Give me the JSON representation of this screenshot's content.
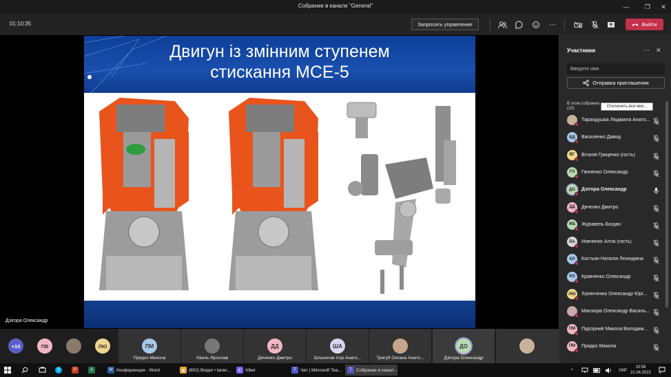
{
  "window": {
    "title": "Собрание в канале \"General\""
  },
  "toolbar": {
    "timer": "01:10:35",
    "request_control": "Запросить управление",
    "leave": "Выйти"
  },
  "slide": {
    "title_line1": "Двигун із змінним ступенем",
    "title_line2": "стискання MCE-5"
  },
  "stage": {
    "speaker": "Дзігора Олександр"
  },
  "panel": {
    "title": "Участники",
    "search_placeholder": "Введите имя",
    "invite": "Отправка приглашения",
    "section_line1": "В этом собрании",
    "section_line2": "(20)",
    "mute_all": "Отключить все мик...",
    "participants": [
      {
        "name": "Тарандушка Людмила Анато...",
        "initials": "",
        "color": "#c8b39a",
        "photo": true
      },
      {
        "name": "Василенко Давид",
        "initials": "ВД",
        "color": "#a6c8ea"
      },
      {
        "name": "Віталій Гриценко (гость)",
        "initials": "ВГ",
        "color": "#f0d58c"
      },
      {
        "name": "Ганненко Олександр",
        "initials": "ГО",
        "color": "#b7dcb0"
      },
      {
        "name": "Дзігора Олександр",
        "initials": "ДО",
        "color": "#b7dcb0"
      },
      {
        "name": "Дяченко Дмитро",
        "initials": "ДД",
        "color": "#f1b7c1"
      },
      {
        "name": "Журавель Богдан",
        "initials": "ЖБ",
        "color": "#b7dcb0"
      },
      {
        "name": "Йовченко Алла (гость)",
        "initials": "ЙА",
        "color": "#d9d9d9"
      },
      {
        "name": "Костьян Наталія Леонідівна",
        "initials": "КЛ",
        "color": "#a6c8ea"
      },
      {
        "name": "Кравченко Олександр",
        "initials": "КО",
        "color": "#a6c8ea"
      },
      {
        "name": "Лукянченко Олександр Юрі...",
        "initials": "ЛЮ",
        "color": "#f0d58c"
      },
      {
        "name": "Манзюра Олександр Василь...",
        "initials": "",
        "color": "#c9a9a9",
        "photo": true
      },
      {
        "name": "Підгорний Микола Володим...",
        "initials": "ПМ",
        "color": "#f1b7c1"
      },
      {
        "name": "Прядко Микола",
        "initials": "ПМ",
        "color": "#f1b7c1"
      }
    ]
  },
  "tiles": {
    "overflow": "+10",
    "small": [
      {
        "initials": "ПВ",
        "color": "#f1b7c1"
      },
      {
        "initials": "ЛЮ",
        "color": "#f0d58c"
      }
    ],
    "named": [
      {
        "name": "Прядко Микола",
        "initials": "ПМ",
        "color": "#a6c8ea"
      },
      {
        "name": "Хвиль Ярослав",
        "initials": "",
        "color": "#777"
      },
      {
        "name": "Дяченко Дмитро",
        "initials": "ДД",
        "color": "#f1b7c1"
      },
      {
        "name": "Шльончак Ігор Анато...",
        "initials": "ША",
        "color": "#d9d4ef"
      },
      {
        "name": "Тригуб Оксана Анато...",
        "initials": "",
        "color": "#c8a58a"
      },
      {
        "name": "Дзігора Олександр",
        "initials": "ДО",
        "color": "#b7dcb0"
      }
    ]
  },
  "taskbar": {
    "apps": [
      {
        "label": "Конференция - Word",
        "color": "#2b579a",
        "glyph": "W"
      },
      {
        "label": "(802) Вхідні • taran...",
        "color": "#e2a33a",
        "glyph": "◉"
      },
      {
        "label": "Viber",
        "color": "#7360f2",
        "glyph": "✆"
      },
      {
        "label": "Чат | Microsoft Tea...",
        "color": "#5059c9",
        "glyph": "T"
      },
      {
        "label": "Собрание в канал...",
        "color": "#5059c9",
        "glyph": "T"
      }
    ],
    "lang": "УКР",
    "time": "10:56",
    "date": "21.04.2021"
  }
}
